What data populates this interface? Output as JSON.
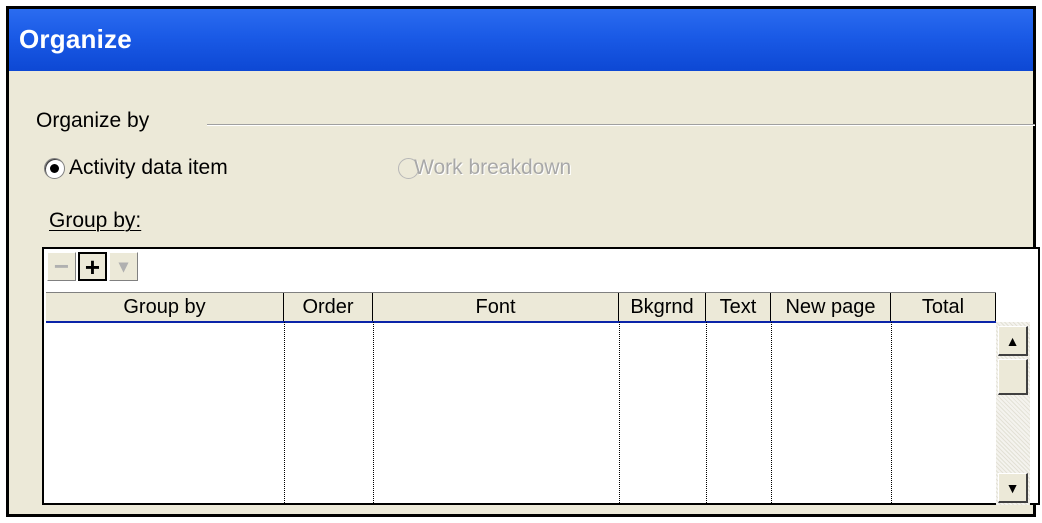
{
  "window": {
    "title": "Organize"
  },
  "organize_by": {
    "label": "Organize by",
    "options": [
      {
        "label": "Activity data item",
        "selected": true,
        "enabled": true
      },
      {
        "label": "Work breakdown",
        "selected": false,
        "enabled": false
      }
    ]
  },
  "group_by": {
    "label": "Group by:",
    "toolbar": {
      "remove_glyph": "−",
      "add_glyph": "+",
      "dropdown_glyph": "▾"
    },
    "columns": [
      "Group by",
      "Order",
      "Font",
      "Bkgrnd",
      "Text",
      "New page",
      "Total"
    ],
    "rows": []
  },
  "scrollbar": {
    "up_glyph": "▲",
    "down_glyph": "▼"
  }
}
